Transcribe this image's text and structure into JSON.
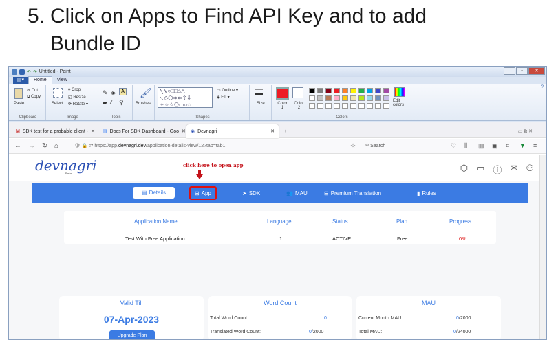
{
  "heading": {
    "num": "5.",
    "line1": "Click on Apps to Find API Key and to add",
    "line2": "Bundle ID"
  },
  "paint": {
    "title": "Untitled - Paint",
    "tabs": [
      "Home",
      "View"
    ],
    "clipboard": {
      "paste": "Paste",
      "cut": "Cut",
      "copy": "Copy",
      "label": "Clipboard"
    },
    "image": {
      "select": "Select",
      "crop": "Crop",
      "resize": "Resize",
      "rotate": "Rotate",
      "label": "Image"
    },
    "tools": {
      "label": "Tools"
    },
    "brushes": "Brushes",
    "shapes": {
      "outline": "Outline",
      "fill": "Fill",
      "label": "Shapes"
    },
    "size": "Size",
    "color1": "Color 1",
    "color2": "Color 2",
    "edit_colors": "Edit colors",
    "colors_label": "Colors",
    "palette": [
      "#000000",
      "#7f7f7f",
      "#880015",
      "#ed1c24",
      "#ff7f27",
      "#fff200",
      "#22b14c",
      "#00a2e8",
      "#3f48cc",
      "#a349a4",
      "#ffffff",
      "#c3c3c3",
      "#b97a57",
      "#ffaec9",
      "#ffc90e",
      "#efe4b0",
      "#b5e61d",
      "#99d9ea",
      "#7092be",
      "#c8bfe7"
    ]
  },
  "browser": {
    "tabs": [
      {
        "label": "SDK test for a probable client - ",
        "icon": "gmail-icon"
      },
      {
        "label": "Docs For SDK Dashboard - Goo",
        "icon": "docs-icon"
      },
      {
        "label": "Devnagri",
        "icon": "devnagri-icon"
      }
    ],
    "url_prefix": "https://app.",
    "url_domain": "devnagri.dev",
    "url_path": "/application-details-view/12?tab=tab1",
    "search_placeholder": "Search"
  },
  "site": {
    "logo": "devnagri",
    "logo_sub": "Beta",
    "annotation": "click here to open app",
    "menu": {
      "details": "Details",
      "app": "App",
      "sdk": "SDK",
      "mau": "MAU",
      "premium": "Premium Translation",
      "rules": "Rules"
    },
    "table": {
      "headers": [
        "Application Name",
        "Language",
        "Status",
        "Plan",
        "Progress"
      ],
      "row": [
        "Test With Free Application",
        "1",
        "ACTIVE",
        "Free",
        "0%"
      ]
    },
    "valid": {
      "title": "Valid Till",
      "date": "07-Apr-2023",
      "button": "Upgrade Plan"
    },
    "word": {
      "title": "Word Count",
      "total_label": "Total Word Count:",
      "total_value": "0",
      "translated_label": "Translated Word Count:",
      "translated_value": "0",
      "translated_max": "/2000"
    },
    "mau": {
      "title": "MAU",
      "current_label": "Current Month MAU:",
      "current_value": "0",
      "current_max": "/2000",
      "total_label": "Total MAU:",
      "total_value": "0",
      "total_max": "/24000"
    },
    "colors": {
      "accent": "#3b7be3",
      "red": "#d11111"
    }
  }
}
